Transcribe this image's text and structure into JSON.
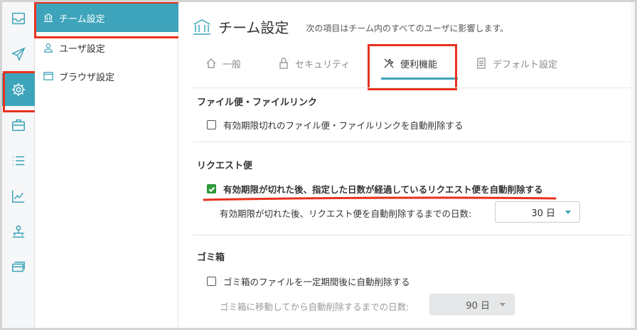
{
  "rail": {
    "items": [
      {
        "icon": "inbox-icon"
      },
      {
        "icon": "send-icon"
      },
      {
        "icon": "gear-icon",
        "active": true
      },
      {
        "icon": "briefcase-icon"
      },
      {
        "icon": "list-icon"
      },
      {
        "icon": "chart-icon"
      },
      {
        "icon": "org-icon"
      },
      {
        "icon": "card-icon"
      }
    ]
  },
  "subnav": {
    "items": [
      {
        "label": "チーム設定",
        "icon": "bank-icon",
        "active": true
      },
      {
        "label": "ユーザ設定",
        "icon": "user-icon"
      },
      {
        "label": "ブラウザ設定",
        "icon": "browser-icon"
      }
    ]
  },
  "header": {
    "title": "チーム設定",
    "subtitle": "次の項目はチーム内のすべてのユーザに影響します。"
  },
  "tabs": [
    {
      "label": "一般",
      "icon": "home-icon"
    },
    {
      "label": "セキュリティ",
      "icon": "lock-icon"
    },
    {
      "label": "便利機能",
      "icon": "tools-icon",
      "active": true
    },
    {
      "label": "デフォルト設定",
      "icon": "document-icon"
    }
  ],
  "sections": {
    "file": {
      "title": "ファイル便・ファイルリンク",
      "option": "有効期限切れのファイル便・ファイルリンクを自動削除する",
      "checked": false
    },
    "request": {
      "title": "リクエスト便",
      "option": "有効期限が切れた後、指定した日数が経過しているリクエスト便を自動削除する",
      "checked": true,
      "days_label": "有効期限が切れた後、リクエスト便を自動削除するまでの日数:",
      "days_value": "30 日"
    },
    "trash": {
      "title": "ゴミ箱",
      "option": "ゴミ箱のファイルを一定期間後に自動削除する",
      "checked": false,
      "days_label": "ゴミ箱に移動してから自動削除するまでの日数:",
      "days_value": "90 日"
    }
  },
  "colors": {
    "accent": "#3ea4bb",
    "highlight": "#e8321f",
    "checked": "#2e9e3b"
  }
}
